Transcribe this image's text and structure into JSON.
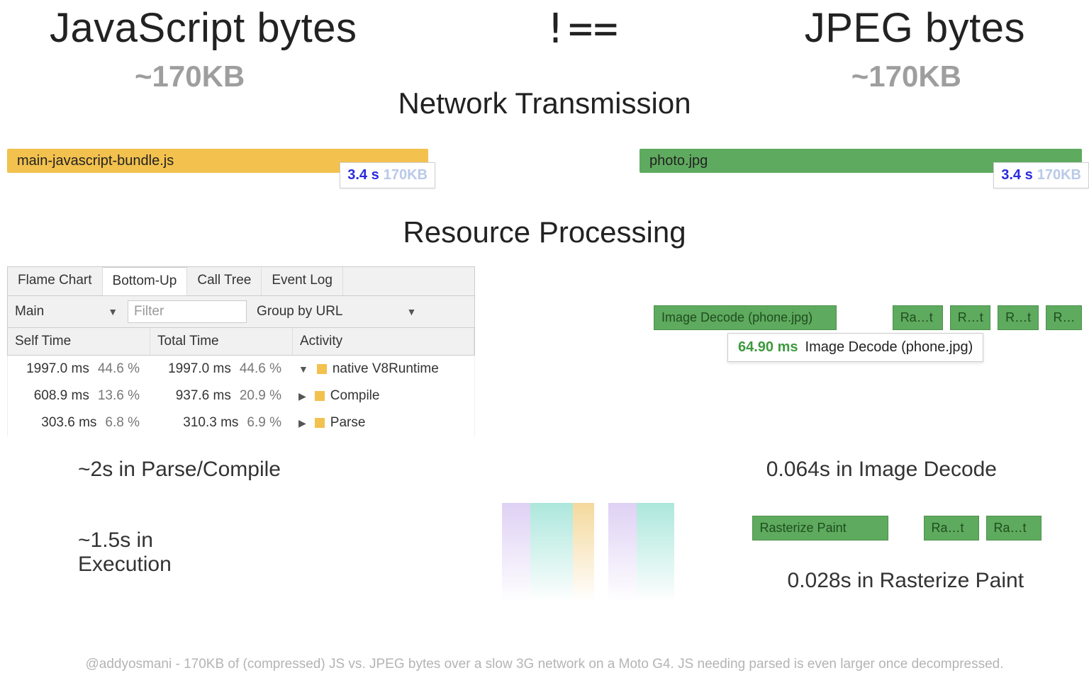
{
  "headline": {
    "left": "JavaScript bytes",
    "op": "!==",
    "right": "JPEG bytes"
  },
  "sizes": {
    "left": "~170KB",
    "right": "~170KB"
  },
  "sections": {
    "network": "Network Transmission",
    "processing": "Resource Processing"
  },
  "bars": {
    "js": {
      "label": "main-javascript-bundle.js",
      "time": "3.4 s",
      "size": "170KB"
    },
    "img": {
      "label": "photo.jpg",
      "time": "3.4 s",
      "size": "170KB"
    }
  },
  "devtools": {
    "tabs": [
      "Flame Chart",
      "Bottom-Up",
      "Call Tree",
      "Event Log"
    ],
    "active_tab": "Bottom-Up",
    "thread": "Main",
    "filter_placeholder": "Filter",
    "group_by": "Group by URL",
    "columns": [
      "Self Time",
      "Total Time",
      "Activity"
    ],
    "rows": [
      {
        "self_ms": "1997.0 ms",
        "self_pct": "44.6 %",
        "self_fill": 100,
        "total_ms": "1997.0 ms",
        "total_pct": "44.6 %",
        "total_fill": 100,
        "activity": "native V8Runtime",
        "expand": "▼"
      },
      {
        "self_ms": "608.9 ms",
        "self_pct": "13.6 %",
        "self_fill": 30,
        "total_ms": "937.6 ms",
        "total_pct": "20.9 %",
        "total_fill": 47,
        "activity": "Compile",
        "expand": "▶"
      },
      {
        "self_ms": "303.6 ms",
        "self_pct": "6.8 %",
        "self_fill": 15,
        "total_ms": "310.3 ms",
        "total_pct": "6.9 %",
        "total_fill": 15,
        "activity": "Parse",
        "expand": "▶"
      }
    ]
  },
  "timeline": {
    "decode_block": "Image Decode (phone.jpg)",
    "small_blocks": [
      "Ra…t",
      "R…t",
      "R…t",
      "R…"
    ],
    "callout_ms": "64.90 ms",
    "callout_label": "Image Decode (phone.jpg)",
    "paint_blocks": [
      "Rasterize Paint",
      "Ra…t",
      "Ra…t"
    ]
  },
  "stats": {
    "js_parse": "~2s in Parse/Compile",
    "img_decode": "0.064s in Image Decode",
    "js_exec": "~1.5s in Execution",
    "img_paint": "0.028s in Rasterize Paint"
  },
  "footnote": "@addyosmani - 170KB of (compressed) JS vs. JPEG bytes over a slow 3G network on a Moto G4. JS needing parsed is even larger once decompressed."
}
